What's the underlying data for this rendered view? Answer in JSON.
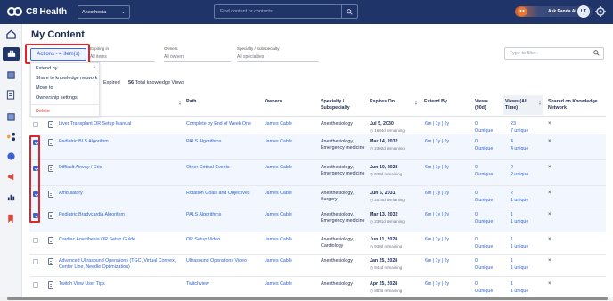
{
  "app": {
    "name": "C8 Health",
    "org_select": "Anesthesia",
    "search_placeholder": "Find content or contacts",
    "user_button": "Ask Panda AI",
    "avatar_initials": "LT"
  },
  "page": {
    "title": "My Content"
  },
  "filters": {
    "expiring_label": "Expiring in",
    "expiring_value": "All items",
    "owners_label": "Owners",
    "owners_value": "All owners",
    "specialty_label": "Specialty / Subspecialty",
    "specialty_value": "All specialties",
    "search_placeholder": "Type to filter"
  },
  "actions": {
    "button_label": "Actions - 4 item(s)",
    "menu": [
      {
        "label": "Extend by",
        "has_submenu": true
      },
      {
        "label": "Share to knowledge network"
      },
      {
        "label": "Move to"
      },
      {
        "label": "Ownership settings"
      },
      {
        "label": "Delete",
        "danger": true
      }
    ]
  },
  "stats": {
    "expired_label": "Expired",
    "views_count": "56",
    "views_label": "Total knowledge Views"
  },
  "table": {
    "headers": {
      "path": "Path",
      "owners": "Owners",
      "specialty": "Specialty / Subspecialty",
      "expires": "Expires On",
      "extend": "Extend By",
      "views90": "Views (90d)",
      "viewsall": "Views (All Time)",
      "shared": "Shared on Knowledge Network"
    },
    "rows": [
      {
        "title": "Liver Transplant OR Setup Manual",
        "path": "Complete by End of Week One",
        "owner": "James Cable",
        "specialty": "Anesthesiology",
        "expires": "Jul 5, 2030",
        "remaining": "1684d remaining",
        "extend": "6m | 1y | 2y",
        "v90": "0",
        "v90u": "0 unique",
        "vall": "23",
        "valluniq": "7 unique",
        "shared": "×",
        "checked": false
      },
      {
        "title": "Pediatric BLS Algorithm",
        "path": "PALS Algorithms",
        "owner": "James Cable",
        "specialty": "Anesthesiology, Emergency medicine",
        "expires": "Mar 14, 2032",
        "remaining": "2302d remaining",
        "extend": "6m | 1y | 2y",
        "v90": "0",
        "v90u": "0 unique",
        "vall": "4",
        "valluniq": "4 unique",
        "shared": "×",
        "checked": true
      },
      {
        "title": "Difficult Airway / Cric",
        "path": "Other Critical Events",
        "owner": "James Cable",
        "specialty": "Anesthesiology, Emergency medicine",
        "expires": "Jun 10, 2028",
        "remaining": "930d remaining",
        "extend": "6m | 1y | 2y",
        "v90": "0",
        "v90u": "0 unique",
        "vall": "2",
        "valluniq": "2 unique",
        "shared": "×",
        "checked": true
      },
      {
        "title": "Ambulatory",
        "path": "Rotation Goals and Objectives",
        "owner": "James Cable",
        "specialty": "Anesthesiology, Surgery",
        "expires": "Jun 6, 2031",
        "remaining": "2020d remaining",
        "extend": "6m | 1y | 2y",
        "v90": "0",
        "v90u": "0 unique",
        "vall": "2",
        "valluniq": "1 unique",
        "shared": "×",
        "checked": true
      },
      {
        "title": "Pediatric Bradycardia Algorithm",
        "path": "PALS Algorithms",
        "owner": "James Cable",
        "specialty": "Anesthesiology, Emergency medicine",
        "expires": "Mar 13, 2032",
        "remaining": "2301d remaining",
        "extend": "6m | 1y | 2y",
        "v90": "0",
        "v90u": "0 unique",
        "vall": "1",
        "valluniq": "1 unique",
        "shared": "×",
        "checked": true
      },
      {
        "title": "Cardiac Anesthesia OR Setup Guide",
        "path": "OR Setup Video",
        "owner": "James Cable",
        "specialty": "Anesthesiology, Cardiology",
        "expires": "Jun 11, 2028",
        "remaining": "930d remaining",
        "extend": "6m | 1y | 2y",
        "v90": "0",
        "v90u": "0 unique",
        "vall": "1",
        "valluniq": "1 unique",
        "shared": "×",
        "checked": false
      },
      {
        "title": "Advanced Ultrasound Operations (TGC, Virtual Convex, Center Line, Needle Optimization)",
        "path": "Ultrasound Operations Video",
        "owner": "James Cable",
        "specialty": "Anesthesiology",
        "expires": "Jan 25, 2028",
        "remaining": "944d remaining",
        "extend": "6m | 1y | 2y",
        "v90": "0",
        "v90u": "0 unique",
        "vall": "1",
        "valluniq": "1 unique",
        "shared": "×",
        "checked": false
      },
      {
        "title": "Twitch View User Tips",
        "path": "Twitchview",
        "owner": "James Cable",
        "specialty": "Anesthesiology",
        "expires": "Apr 25, 2028",
        "remaining": "883d remaining",
        "extend": "6m | 1y | 2y",
        "v90": "0",
        "v90u": "0 unique",
        "vall": "1",
        "valluniq": "1 unique",
        "shared": "×",
        "checked": false
      }
    ]
  },
  "colors": {
    "topbar": "#1f3468",
    "accent": "#2f63cf",
    "highlight": "#e0242c"
  }
}
